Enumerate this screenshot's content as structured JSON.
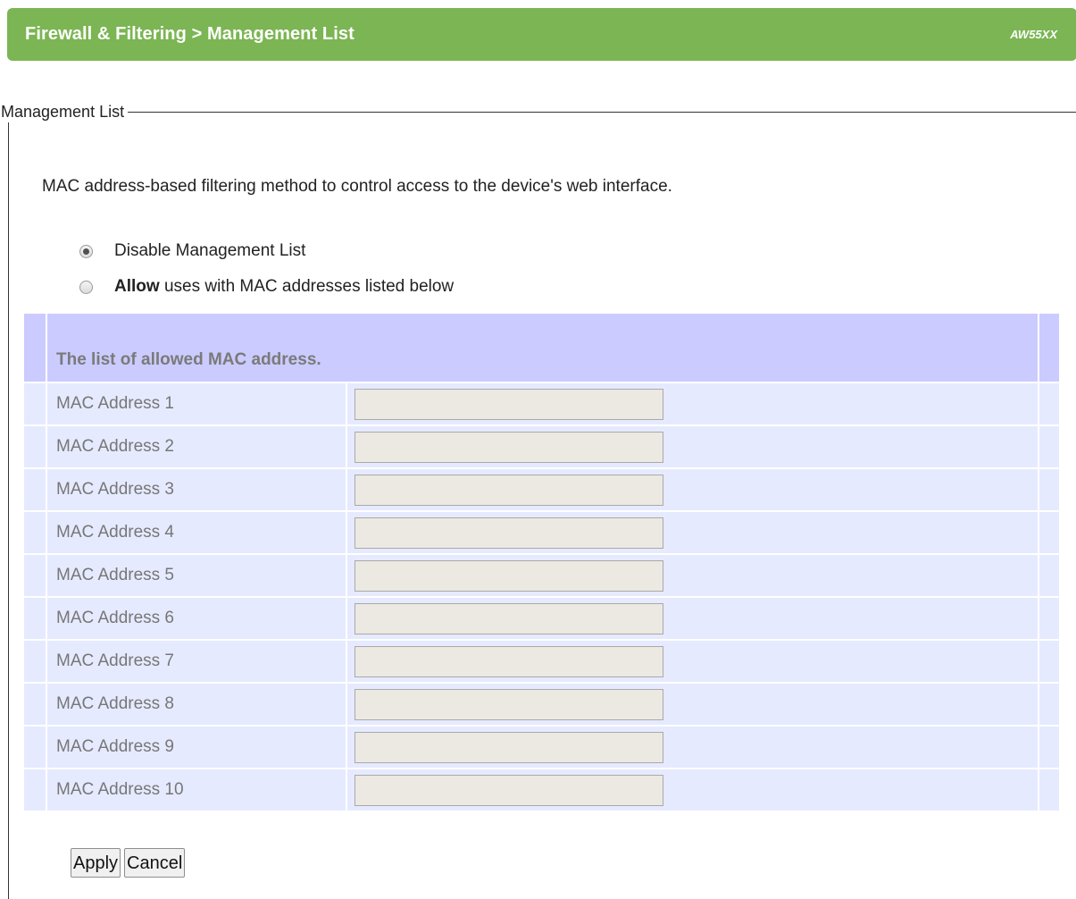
{
  "header": {
    "title": "Firewall & Filtering > Management List",
    "model": "AW55XX"
  },
  "section": {
    "legend": "Management List",
    "description": "MAC address-based filtering method to control access to the device's web interface."
  },
  "options": {
    "disable_label": "Disable Management List",
    "allow_bold": "Allow",
    "allow_rest": " uses with MAC addresses listed below",
    "selected": "disable"
  },
  "table": {
    "heading": "The list of allowed MAC address.",
    "rows": [
      {
        "label": "MAC Address 1",
        "value": ""
      },
      {
        "label": "MAC Address 2",
        "value": ""
      },
      {
        "label": "MAC Address 3",
        "value": ""
      },
      {
        "label": "MAC Address 4",
        "value": ""
      },
      {
        "label": "MAC Address 5",
        "value": ""
      },
      {
        "label": "MAC Address 6",
        "value": ""
      },
      {
        "label": "MAC Address 7",
        "value": ""
      },
      {
        "label": "MAC Address 8",
        "value": ""
      },
      {
        "label": "MAC Address 9",
        "value": ""
      },
      {
        "label": "MAC Address 10",
        "value": ""
      }
    ]
  },
  "buttons": {
    "apply": "Apply",
    "cancel": "Cancel"
  },
  "colors": {
    "header_bg": "#7cb554",
    "table_head_bg": "#cbcbff",
    "table_row_bg": "#e6eaff"
  }
}
